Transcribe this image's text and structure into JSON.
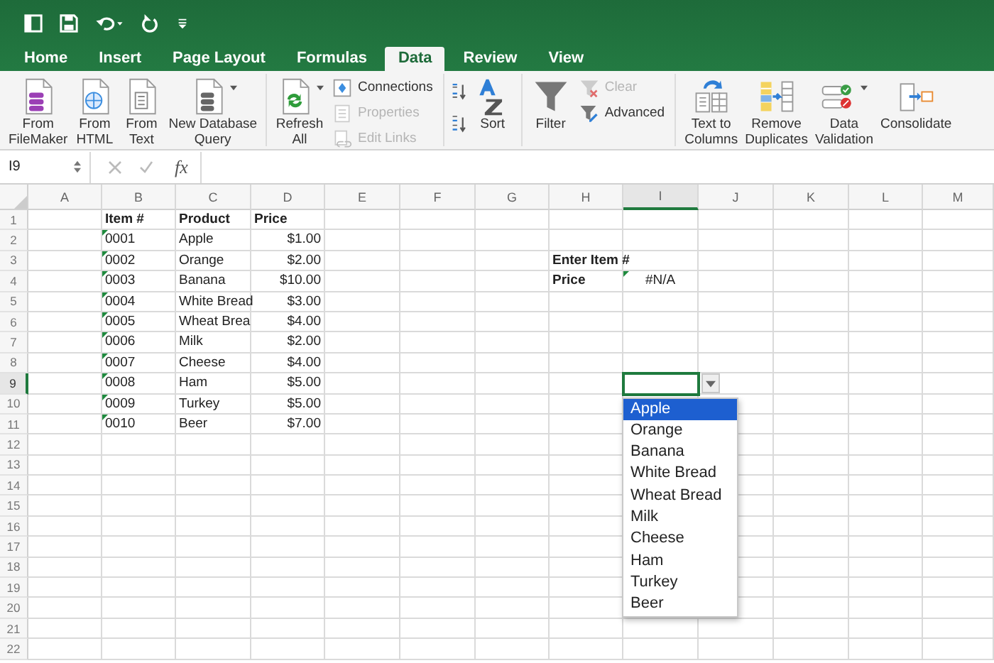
{
  "tabs": [
    {
      "label": "Home",
      "selected": false
    },
    {
      "label": "Insert",
      "selected": false
    },
    {
      "label": "Page Layout",
      "selected": false
    },
    {
      "label": "Formulas",
      "selected": false
    },
    {
      "label": "Data",
      "selected": true
    },
    {
      "label": "Review",
      "selected": false
    },
    {
      "label": "View",
      "selected": false
    }
  ],
  "ribbon": {
    "groups": [
      {
        "items": [
          {
            "kind": "large",
            "label": "From\nFileMaker",
            "menu": false
          },
          {
            "kind": "large",
            "label": "From\nHTML",
            "menu": false
          },
          {
            "kind": "large",
            "label": "From\nText",
            "menu": false
          },
          {
            "kind": "large",
            "label": "New Database\nQuery",
            "menu": true
          }
        ]
      },
      {
        "items": [
          {
            "kind": "large",
            "label": "Refresh\nAll",
            "menu": true
          },
          {
            "kind": "stack",
            "entries": [
              {
                "label": "Connections",
                "disabled": false
              },
              {
                "label": "Properties",
                "disabled": true
              },
              {
                "label": "Edit Links",
                "disabled": true
              }
            ]
          }
        ]
      },
      {
        "items": [
          {
            "kind": "sort-pair"
          },
          {
            "kind": "large",
            "label": "Sort",
            "menu": false
          }
        ]
      },
      {
        "items": [
          {
            "kind": "large",
            "label": "Filter",
            "menu": false
          },
          {
            "kind": "stack",
            "entries": [
              {
                "label": "Clear",
                "disabled": true
              },
              {
                "label": "Advanced",
                "disabled": false
              }
            ]
          }
        ]
      },
      {
        "items": [
          {
            "kind": "large",
            "label": "Text to\nColumns",
            "menu": false
          },
          {
            "kind": "large",
            "label": "Remove\nDuplicates",
            "menu": false
          },
          {
            "kind": "large",
            "label": "Data\nValidation",
            "menu": true
          },
          {
            "kind": "large",
            "label": "Consolidate",
            "menu": false
          }
        ]
      }
    ]
  },
  "formula_bar": {
    "name_box": "I9",
    "function_label": "fx"
  },
  "sheet": {
    "columns": [
      {
        "label": "A",
        "selected": false
      },
      {
        "label": "B",
        "selected": false
      },
      {
        "label": "C",
        "selected": false
      },
      {
        "label": "D",
        "selected": false
      },
      {
        "label": "E",
        "selected": false
      },
      {
        "label": "F",
        "selected": false
      },
      {
        "label": "G",
        "selected": false
      },
      {
        "label": "H",
        "selected": false
      },
      {
        "label": "I",
        "selected": true
      },
      {
        "label": "J",
        "selected": false
      },
      {
        "label": "K",
        "selected": false
      },
      {
        "label": "L",
        "selected": false
      },
      {
        "label": "M",
        "selected": false
      }
    ],
    "rows": [
      {
        "label": "1",
        "selected": false
      },
      {
        "label": "2",
        "selected": false
      },
      {
        "label": "3",
        "selected": false
      },
      {
        "label": "4",
        "selected": false
      },
      {
        "label": "5",
        "selected": false
      },
      {
        "label": "6",
        "selected": false
      },
      {
        "label": "7",
        "selected": false
      },
      {
        "label": "8",
        "selected": false
      },
      {
        "label": "9",
        "selected": true
      },
      {
        "label": "10",
        "selected": false
      },
      {
        "label": "11",
        "selected": false
      },
      {
        "label": "12",
        "selected": false
      },
      {
        "label": "13",
        "selected": false
      },
      {
        "label": "14",
        "selected": false
      },
      {
        "label": "15",
        "selected": false
      },
      {
        "label": "16",
        "selected": false
      },
      {
        "label": "17",
        "selected": false
      },
      {
        "label": "18",
        "selected": false
      },
      {
        "label": "19",
        "selected": false
      },
      {
        "label": "20",
        "selected": false
      },
      {
        "label": "21",
        "selected": false
      },
      {
        "label": "22",
        "selected": false
      }
    ],
    "items": {
      "header": [
        "Item #",
        "Product",
        "Price"
      ],
      "rows": [
        {
          "item": "0001",
          "product": "Apple",
          "price": "$1.00",
          "flagged": true
        },
        {
          "item": "0002",
          "product": "Orange",
          "price": "$2.00",
          "flagged": true
        },
        {
          "item": "0003",
          "product": "Banana",
          "price": "$10.00",
          "flagged": true
        },
        {
          "item": "0004",
          "product": "White Bread",
          "price": "$3.00",
          "flagged": true
        },
        {
          "item": "0005",
          "product": "Wheat Brea",
          "price": "$4.00",
          "flagged": true
        },
        {
          "item": "0006",
          "product": "Milk",
          "price": "$2.00",
          "flagged": true
        },
        {
          "item": "0007",
          "product": "Cheese",
          "price": "$4.00",
          "flagged": true
        },
        {
          "item": "0008",
          "product": "Ham",
          "price": "$5.00",
          "flagged": true
        },
        {
          "item": "0009",
          "product": "Turkey",
          "price": "$5.00",
          "flagged": true
        },
        {
          "item": "0010",
          "product": "Beer",
          "price": "$7.00",
          "flagged": true
        }
      ]
    },
    "lookup": {
      "prompt": "Enter Item #",
      "label": "Price",
      "result": "#N/A",
      "flagged": true
    },
    "dropdown": {
      "options": [
        {
          "label": "Apple",
          "selected": true
        },
        {
          "label": "Orange",
          "selected": false
        },
        {
          "label": "Banana",
          "selected": false
        },
        {
          "label": "White Bread",
          "selected": false
        },
        {
          "label": "Wheat Bread",
          "selected": false
        },
        {
          "label": "Milk",
          "selected": false
        },
        {
          "label": "Cheese",
          "selected": false
        },
        {
          "label": "Ham",
          "selected": false
        },
        {
          "label": "Turkey",
          "selected": false
        },
        {
          "label": "Beer",
          "selected": false
        }
      ]
    }
  }
}
